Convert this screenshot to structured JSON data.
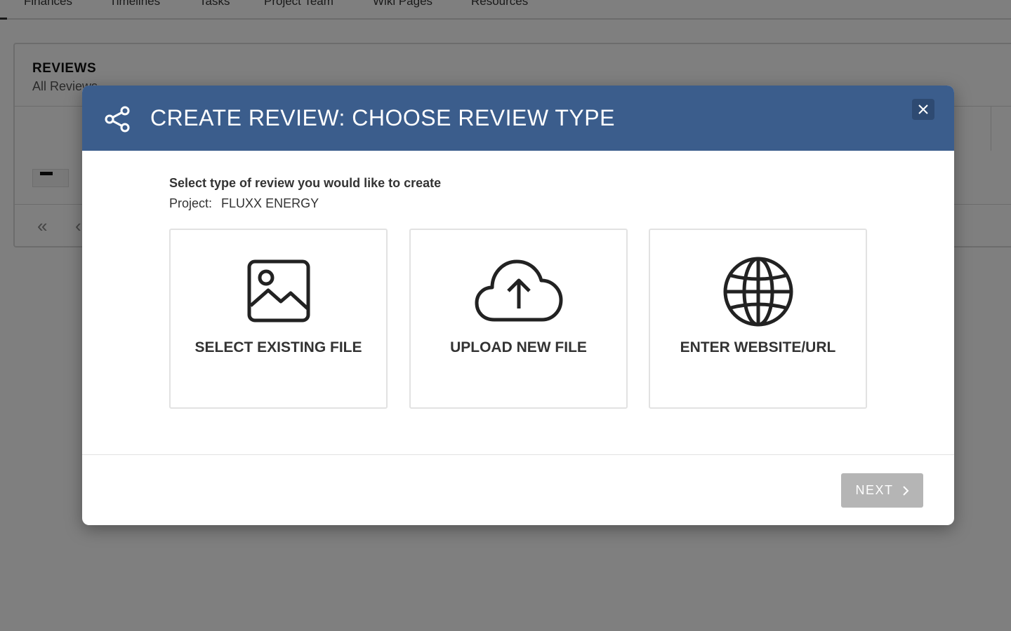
{
  "background": {
    "tabs": [
      "Finances",
      "Timelines",
      "Tasks",
      "Project Team",
      "Wiki Pages",
      "Resources"
    ],
    "reviews_panel": {
      "title": "REVIEWS",
      "subtitle": "All Reviews",
      "pager_first": "«",
      "pager_prev": "‹"
    }
  },
  "modal": {
    "title": "CREATE REVIEW: CHOOSE REVIEW TYPE",
    "header_color": "#3b5d8c",
    "header_icon": "share-icon",
    "close_icon": "close-icon",
    "prompt": "Select type of review you would like to create",
    "project_label": "Project:",
    "project_name": "FLUXX ENERGY",
    "options": [
      {
        "label": "SELECT EXISTING FILE",
        "icon": "image-icon"
      },
      {
        "label": "UPLOAD NEW FILE",
        "icon": "cloud-upload-icon"
      },
      {
        "label": "ENTER WEBSITE/URL",
        "icon": "globe-icon"
      }
    ],
    "next_button": {
      "label": "NEXT",
      "icon": "chevron-right-icon",
      "state": "disabled"
    }
  }
}
